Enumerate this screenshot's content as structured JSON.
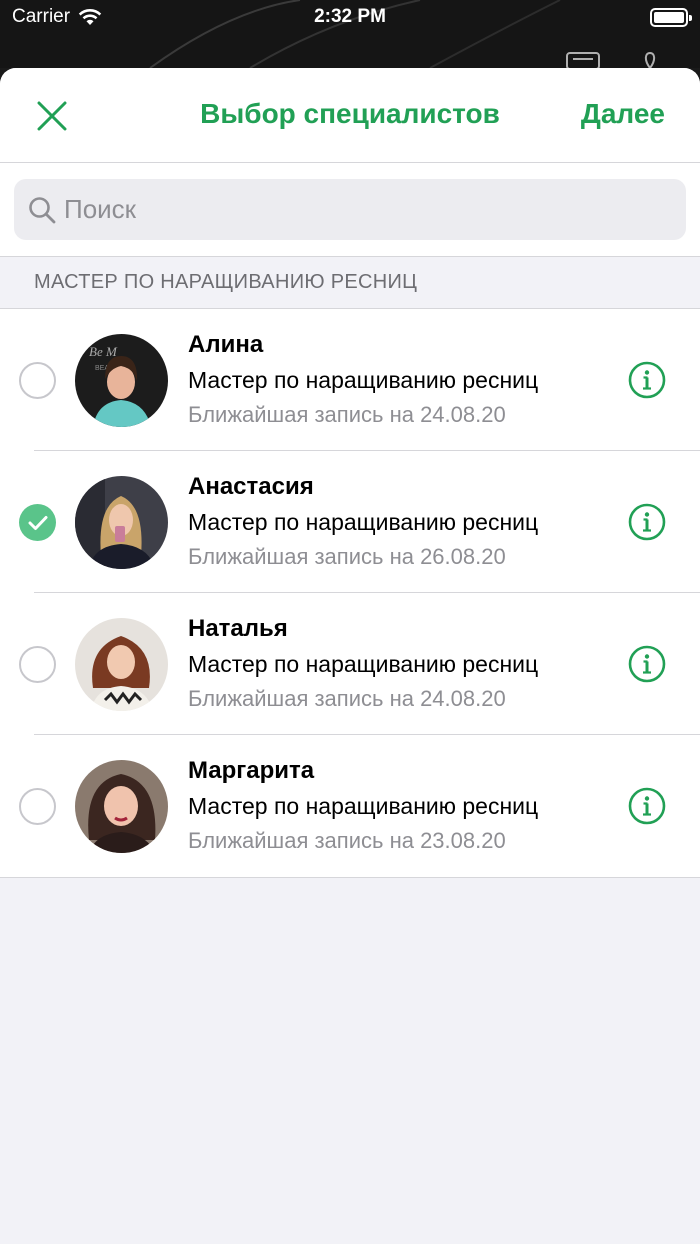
{
  "status_bar": {
    "carrier": "Carrier",
    "time": "2:32 PM"
  },
  "nav": {
    "title": "Выбор специалистов",
    "next_label": "Далее"
  },
  "search": {
    "placeholder": "Поиск"
  },
  "section": {
    "title": "МАСТЕР ПО НАРАЩИВАНИЮ РЕСНИЦ"
  },
  "specialists": [
    {
      "name": "Алина",
      "role": "Мастер по наращиванию ресниц",
      "next": "Ближайшая запись на 24.08.20",
      "selected": false
    },
    {
      "name": "Анастасия",
      "role": "Мастер по наращиванию ресниц",
      "next": "Ближайшая запись на 26.08.20",
      "selected": true
    },
    {
      "name": "Наталья",
      "role": "Мастер по наращиванию ресниц",
      "next": "Ближайшая запись на 24.08.20",
      "selected": false
    },
    {
      "name": "Маргарита",
      "role": "Мастер по наращиванию ресниц",
      "next": "Ближайшая запись на 23.08.20",
      "selected": false
    }
  ],
  "colors": {
    "accent": "#21a055",
    "selected": "#5ac48a"
  }
}
